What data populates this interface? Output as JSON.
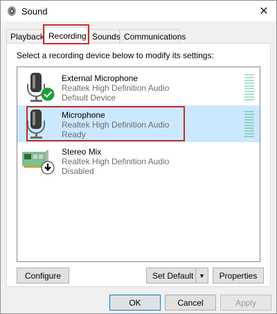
{
  "window": {
    "title": "Sound",
    "title_icon": "speaker-icon",
    "close_glyph": "✕"
  },
  "tabs": [
    {
      "label": "Playback",
      "active": false
    },
    {
      "label": "Recording",
      "active": true
    },
    {
      "label": "Sounds",
      "active": false
    },
    {
      "label": "Communications",
      "active": false
    }
  ],
  "panel": {
    "instruction": "Select a recording device below to modify its settings:",
    "devices": [
      {
        "name": "External Microphone",
        "driver": "Realtek High Definition Audio",
        "state": "Default Device",
        "icon": "microphone-icon",
        "badge": "default-check-icon",
        "selected": false
      },
      {
        "name": "Microphone",
        "driver": "Realtek High Definition Audio",
        "state": "Ready",
        "icon": "microphone-icon",
        "selected": true
      },
      {
        "name": "Stereo Mix",
        "driver": "Realtek High Definition Audio",
        "state": "Disabled",
        "icon": "sound-card-icon",
        "badge": "disabled-arrow-icon",
        "selected": false
      }
    ],
    "buttons": {
      "configure": "Configure",
      "set_default": "Set Default",
      "set_default_arrow": "▼",
      "properties": "Properties"
    }
  },
  "footer": {
    "ok": "OK",
    "cancel": "Cancel",
    "apply": "Apply"
  },
  "colors": {
    "selection": "#cce8ff",
    "highlight_box": "#d12a2a",
    "check_green": "#1e9e3c",
    "level_meter": "#aee0cc"
  }
}
